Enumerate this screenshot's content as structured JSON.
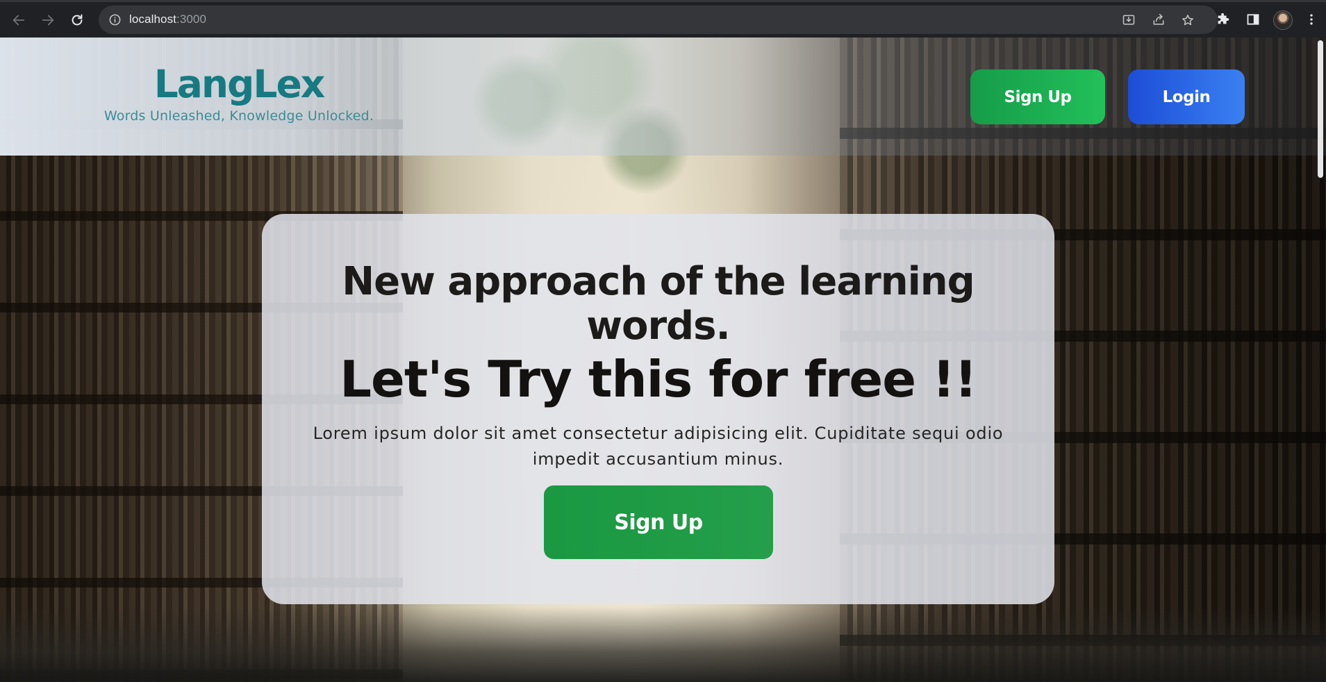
{
  "browser": {
    "url_host": "localhost",
    "url_port": ":3000",
    "icons": {
      "back": "arrow-left-icon",
      "forward": "arrow-right-icon",
      "reload": "reload-icon",
      "site_info": "info-circle-icon",
      "install": "install-app-icon",
      "share": "share-icon",
      "bookmark": "star-icon",
      "extensions": "puzzle-icon",
      "side_panel": "side-panel-icon",
      "menu": "kebab-menu-icon"
    }
  },
  "header": {
    "brand_name": "LangLex",
    "tagline": "Words Unleashed, Knowledge Unlocked.",
    "signup_label": "Sign Up",
    "login_label": "Login"
  },
  "hero": {
    "heading_line1": "New approach of the learning",
    "heading_line2": "words.",
    "cta_title": "Let's Try this for free !!",
    "description": "Lorem ipsum dolor sit amet consectetur adipisicing elit. Cupiditate sequi odio impedit accusantium minus.",
    "signup_label": "Sign Up"
  },
  "colors": {
    "brand": "#177a82",
    "signup_green": "#22c05a",
    "login_blue": "#3a80f2",
    "hero_signup_green": "#1a9842"
  }
}
